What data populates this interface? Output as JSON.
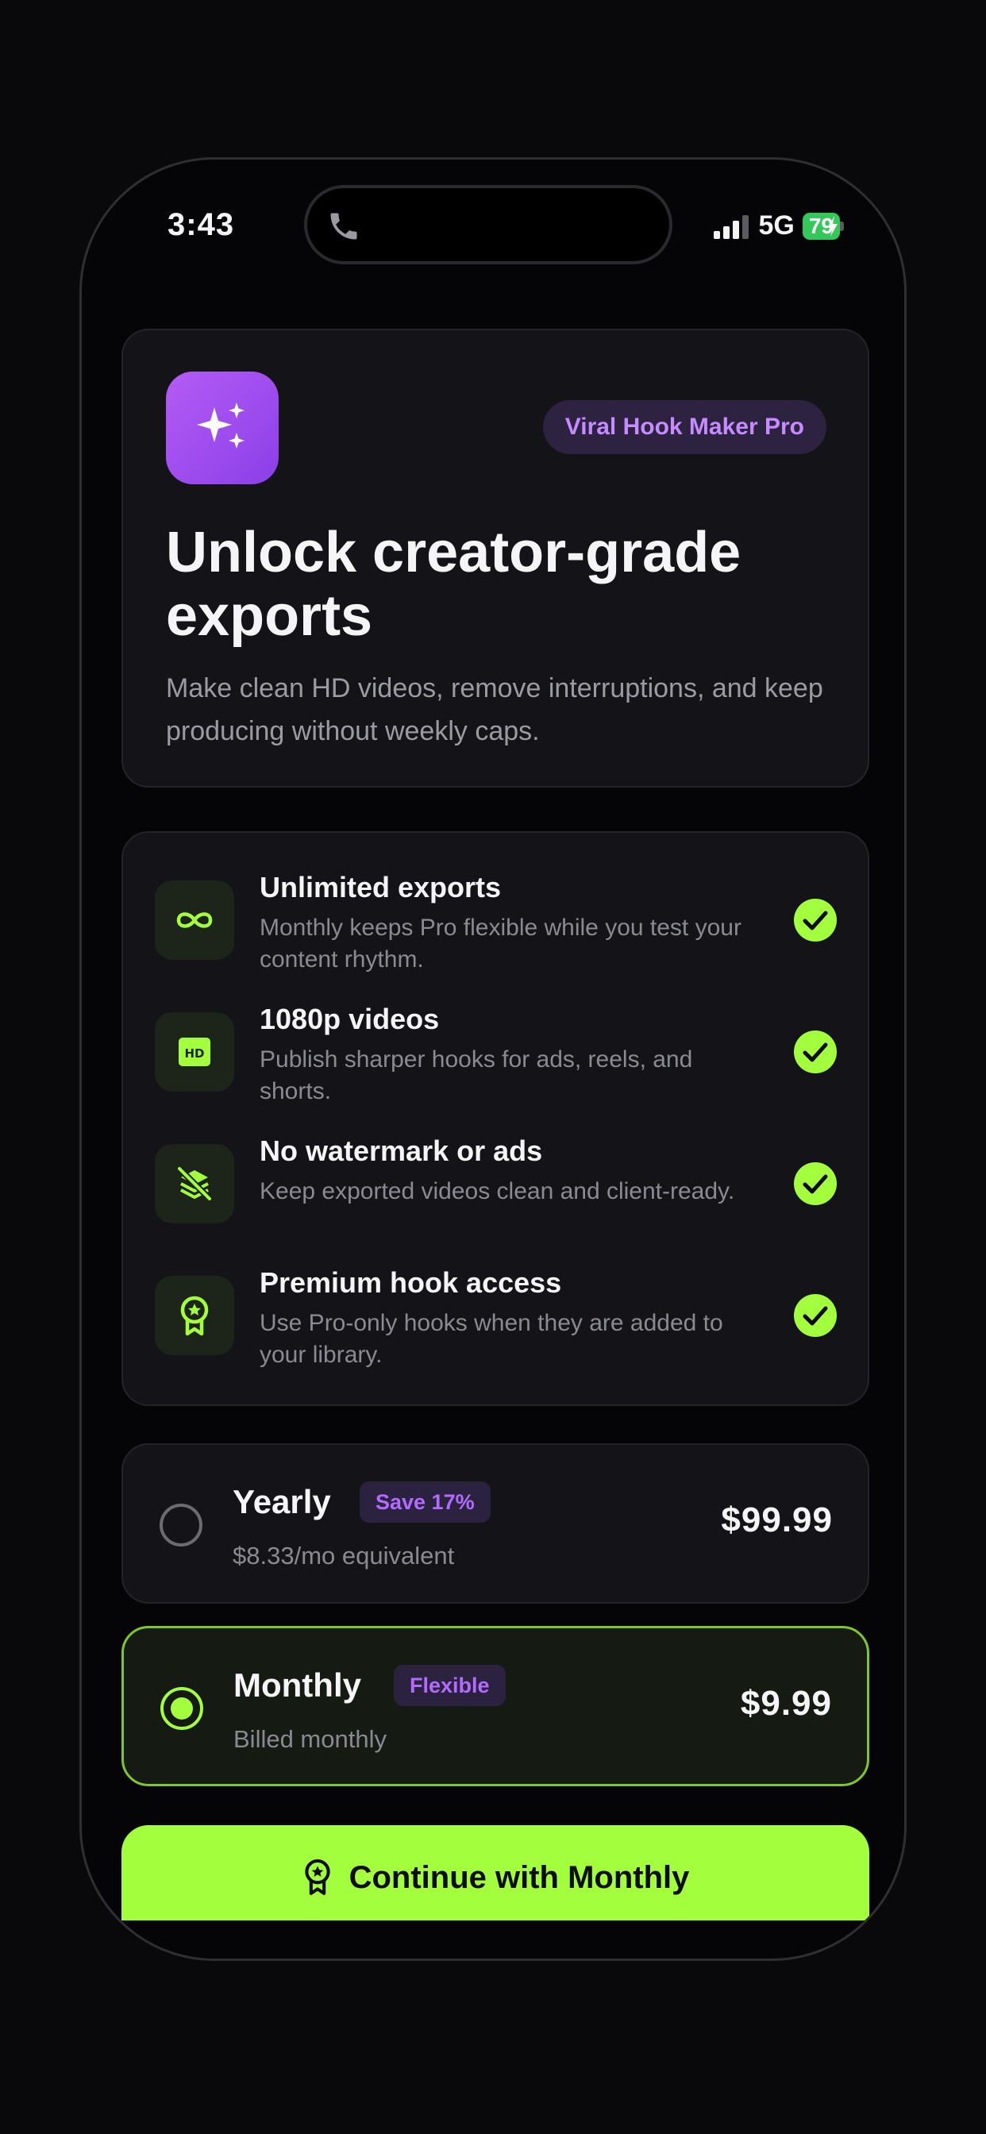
{
  "status_bar": {
    "time": "3:43",
    "network": "5G",
    "battery": "79"
  },
  "hero": {
    "badge": "Viral Hook Maker Pro",
    "title": "Unlock creator-grade exports",
    "subtitle": "Make clean HD videos, remove interruptions, and keep producing without weekly caps."
  },
  "features": [
    {
      "icon": "infinity-icon",
      "title": "Unlimited exports",
      "desc": "Monthly keeps Pro flexible while you test your content rhythm."
    },
    {
      "icon": "hd-icon",
      "title": "1080p videos",
      "desc": "Publish sharper hooks for ads, reels, and shorts."
    },
    {
      "icon": "no-watermark-icon",
      "title": "No watermark or ads",
      "desc": "Keep exported videos clean and client-ready."
    },
    {
      "icon": "award-icon",
      "title": "Premium hook access",
      "desc": "Use Pro-only hooks when they are added to your library."
    }
  ],
  "plans": {
    "yearly": {
      "name": "Yearly",
      "tag": "Save 17%",
      "sub": "$8.33/mo equivalent",
      "price": "$99.99",
      "selected": false
    },
    "monthly": {
      "name": "Monthly",
      "tag": "Flexible",
      "sub": "Billed monthly",
      "price": "$9.99",
      "selected": true
    }
  },
  "cta": {
    "label": "Continue with Monthly"
  },
  "colors": {
    "accent": "#a3ff3d",
    "purple": "#b36bff",
    "background": "#050507"
  }
}
